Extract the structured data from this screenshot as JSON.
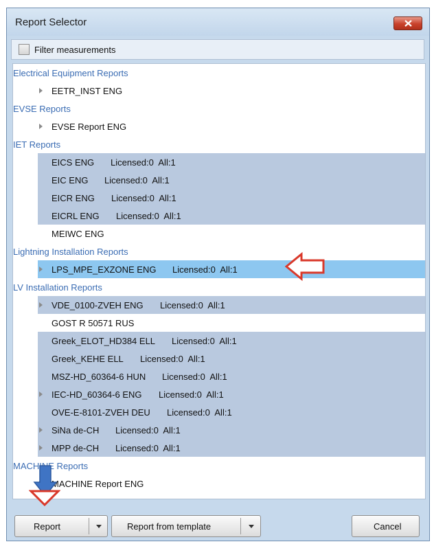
{
  "window": {
    "title": "Report Selector"
  },
  "filter": {
    "label": "Filter measurements",
    "checked": false
  },
  "list": {
    "groups": [
      {
        "name": "Electrical Equipment Reports",
        "items": [
          {
            "name": "EETR_INST ENG",
            "meta": "",
            "expandable": true,
            "style": "plain"
          }
        ]
      },
      {
        "name": "EVSE Reports",
        "items": [
          {
            "name": "EVSE Report ENG",
            "meta": "",
            "expandable": true,
            "style": "plain"
          }
        ]
      },
      {
        "name": "IET Reports",
        "items": [
          {
            "name": "EICS ENG",
            "meta": "Licensed:0  All:1",
            "expandable": false,
            "style": "lic"
          },
          {
            "name": "EIC ENG",
            "meta": "Licensed:0  All:1",
            "expandable": false,
            "style": "lic"
          },
          {
            "name": "EICR ENG",
            "meta": "Licensed:0  All:1",
            "expandable": false,
            "style": "lic"
          },
          {
            "name": "EICRL ENG",
            "meta": "Licensed:0  All:1",
            "expandable": false,
            "style": "lic"
          },
          {
            "name": "MEIWC ENG",
            "meta": "",
            "expandable": false,
            "style": "plain"
          }
        ]
      },
      {
        "name": "Lightning Installation Reports",
        "items": [
          {
            "name": "LPS_MPE_EXZONE ENG",
            "meta": "Licensed:0  All:1",
            "expandable": true,
            "style": "sel"
          }
        ]
      },
      {
        "name": "LV Installation Reports",
        "items": [
          {
            "name": "VDE_0100-ZVEH ENG",
            "meta": "Licensed:0  All:1",
            "expandable": true,
            "style": "lic"
          },
          {
            "name": "GOST R 50571 RUS",
            "meta": "",
            "expandable": false,
            "style": "plain"
          },
          {
            "name": "Greek_ELOT_HD384 ELL",
            "meta": "Licensed:0  All:1",
            "expandable": false,
            "style": "lic"
          },
          {
            "name": "Greek_KEHE ELL",
            "meta": "Licensed:0  All:1",
            "expandable": false,
            "style": "lic"
          },
          {
            "name": "MSZ-HD_60364-6 HUN",
            "meta": "Licensed:0  All:1",
            "expandable": false,
            "style": "lic"
          },
          {
            "name": "IEC-HD_60364-6 ENG",
            "meta": "Licensed:0  All:1",
            "expandable": true,
            "style": "lic"
          },
          {
            "name": "OVE-E-8101-ZVEH DEU",
            "meta": "Licensed:0  All:1",
            "expandable": false,
            "style": "lic"
          },
          {
            "name": "SiNa de-CH",
            "meta": "Licensed:0  All:1",
            "expandable": true,
            "style": "lic"
          },
          {
            "name": "MPP de-CH",
            "meta": "Licensed:0  All:1",
            "expandable": true,
            "style": "lic"
          }
        ]
      },
      {
        "name": "MACHINE Reports",
        "items": [
          {
            "name": "MACHINE Report ENG",
            "meta": "",
            "expandable": true,
            "style": "plain"
          }
        ]
      }
    ]
  },
  "buttons": {
    "report": "Report",
    "report_from_template": "Report from template",
    "cancel": "Cancel"
  },
  "colors": {
    "selected_row": "#8dc7f0",
    "licensed_row": "#b9c9df",
    "group_text": "#3a6cb3",
    "callout_red": "#d9382a",
    "callout_blue": "#3f74c4"
  }
}
